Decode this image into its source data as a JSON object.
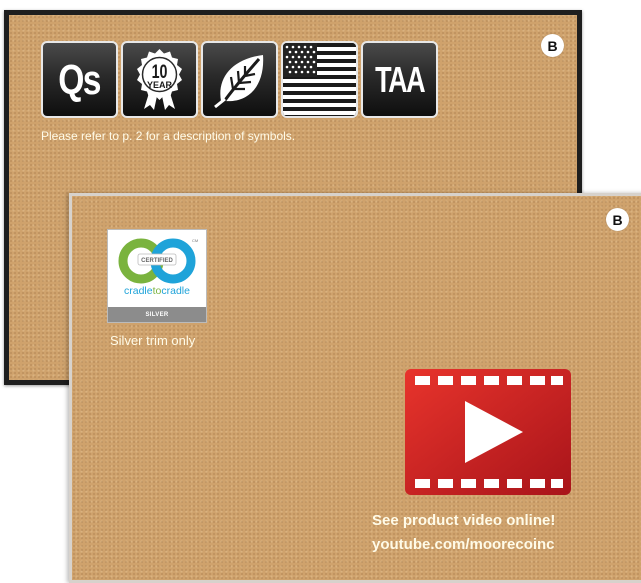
{
  "back_board": {
    "badge": "B",
    "symbols": [
      {
        "name": "Qs",
        "label": "Qs"
      },
      {
        "name": "10-year-warranty",
        "number": "10",
        "label": "YEAR"
      },
      {
        "name": "leaf",
        "icon": "leaf-icon"
      },
      {
        "name": "us-flag",
        "icon": "us-flag-icon"
      },
      {
        "name": "TAA",
        "label": "TAA"
      }
    ],
    "note": "Please refer to p. 2 for a description of symbols."
  },
  "front_board": {
    "badge": "B",
    "certification": {
      "certified": "CERTIFIED",
      "cm": "CM",
      "brand_left": "cradle",
      "brand_mid": "to",
      "brand_right": "cradle",
      "level": "SILVER"
    },
    "certification_caption": "Silver trim only",
    "video": {
      "icon": "video-play-icon",
      "line1": "See product video online!",
      "line2": "youtube.com/moorecoinc"
    }
  },
  "colors": {
    "cork": "#cfa26c",
    "frame_black": "#1e1e1e",
    "frame_silver": "#d7d2cc",
    "video_red": "#d8201f",
    "c2c_green": "#7ab33e",
    "c2c_blue": "#1fa3d9"
  }
}
